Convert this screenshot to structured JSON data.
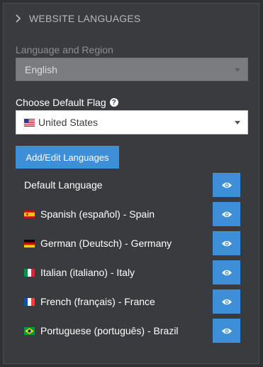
{
  "section": {
    "title": "WEBSITE LANGUAGES",
    "icon": "chevron-right-icon"
  },
  "language_region": {
    "label": "Language and Region",
    "selected": "English"
  },
  "default_flag": {
    "label": "Choose Default Flag",
    "help_icon": "help-icon",
    "selected": "United States",
    "selected_flag": "us-flag-icon"
  },
  "add_edit_button": "Add/Edit Languages",
  "languages": [
    {
      "label": "Default Language",
      "flag": ""
    },
    {
      "label": "Spanish (español) - Spain",
      "flag": "spain-flag-icon"
    },
    {
      "label": "German (Deutsch) - Germany",
      "flag": "germany-flag-icon"
    },
    {
      "label": "Italian (italiano) - Italy",
      "flag": "italy-flag-icon"
    },
    {
      "label": "French (français) - France",
      "flag": "france-flag-icon"
    },
    {
      "label": "Portuguese (português) - Brazil",
      "flag": "brazil-flag-icon"
    }
  ],
  "colors": {
    "background": "#2f3033",
    "panel": "#3a3b3e",
    "accent": "#3f8fd8",
    "disabled_select": "#7b7c7f"
  }
}
